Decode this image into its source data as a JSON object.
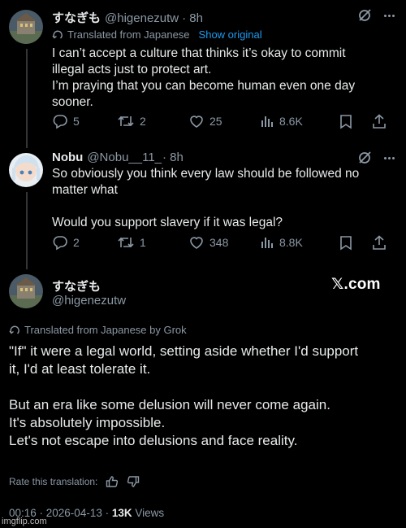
{
  "post1": {
    "display_name": "すなぎも",
    "handle": "@higenezutw",
    "time": "· 8h",
    "translated_label": "Translated from Japanese",
    "show_original": "Show original",
    "lines": [
      "I can’t accept a culture that thinks it’s okay to commit",
      "illegal acts just to protect art.",
      "I’m praying that you can become human even one day",
      "sooner."
    ],
    "replies": "5",
    "reposts": "2",
    "likes": "25",
    "views": "8.6K"
  },
  "post2": {
    "display_name": "Nobu",
    "handle": "@Nobu__11_",
    "time": "· 8h",
    "lines": [
      "So obviously you think every law should be followed no",
      "matter what",
      "",
      "Would you support slavery if it was legal?"
    ],
    "replies": "2",
    "reposts": "1",
    "likes": "348",
    "views": "8.8K"
  },
  "post3": {
    "display_name": "すなぎも",
    "handle": "@higenezutw",
    "brand": "𝕏.com",
    "translated_label": "Translated from Japanese by Grok",
    "lines": [
      "\"If\" it were a legal world, setting aside whether I'd support",
      "it, I'd at least tolerate it.",
      "",
      "But an era like some delusion will never come again.",
      "It's absolutely impossible.",
      "Let's not escape into delusions and face reality."
    ],
    "rate_label": "Rate this translation:",
    "timestamp": "00:16 · 2026-04-13 · ",
    "view_count": "13K",
    "views_label": " Views"
  },
  "watermark": "imgflip.com",
  "icons": {
    "reply": "reply-icon",
    "repost": "repost-icon",
    "like": "heart-icon",
    "views": "views-icon",
    "bookmark": "bookmark-icon",
    "share": "share-icon",
    "grok": "grok-icon",
    "translate": "translate-icon",
    "thumbs_up": "thumbs-up-icon",
    "thumbs_down": "thumbs-down-icon"
  },
  "colors": {
    "background": "#000000",
    "text": "#e7e9ea",
    "muted": "#8b98a5",
    "link": "#1d9bf0",
    "thread_line": "#333639"
  }
}
